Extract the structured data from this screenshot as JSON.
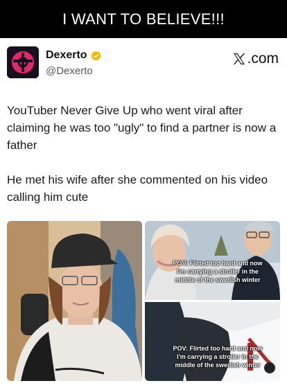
{
  "banner": {
    "text": "I WANT TO BELIEVE!!!"
  },
  "tweet": {
    "display_name": "Dexerto",
    "handle": "@Dexerto",
    "brand": ".com",
    "paragraphs": [
      "YouTuber Never Give Up who went viral after claiming he was too \"ugly\" to find a partner is now a father",
      "He met his wife after she commented on his video calling him cute"
    ]
  },
  "media": {
    "captions": [
      "POV: Flirted too hard and now I'm carrying a stroller in the middle of the swedish winter",
      "POV: Flirted too hard and now I'm carrying a stroller in the middle of the swedish winter"
    ]
  },
  "colors": {
    "banner_bg": "#000000",
    "verified": "#f2b705",
    "avatar_accent": "#e0296b"
  },
  "icons": {
    "verified": "verified-badge-icon",
    "x_logo": "x-logo-icon",
    "avatar": "dexerto-logo-icon"
  }
}
